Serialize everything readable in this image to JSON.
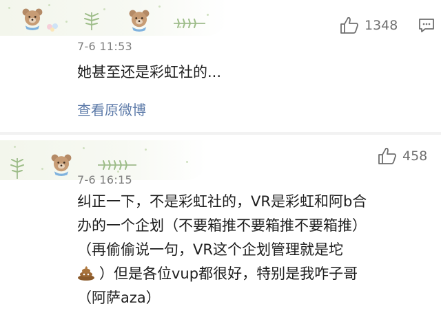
{
  "comments": [
    {
      "timestamp": "7-6 11:53",
      "likes": "1348",
      "text": "她甚至还是彩虹社的...",
      "view_original": "查看原微博"
    },
    {
      "timestamp": "7-6 16:15",
      "likes": "458",
      "lines": [
        "纠正一下，不是彩虹社的，VR是彩虹和阿b合",
        "办的一个企划（不要箱推不要箱推不要箱推）",
        "（再偷偷说一句，VR这个企划管理就是坨",
        "）但是各位vup都很好，特别是我咋子哥",
        "（阿萨aza）"
      ]
    }
  ],
  "icons": {
    "like": "thumbs-up-icon",
    "reply": "comment-icon",
    "poop": "poop-emoji-icon",
    "bear": "bear-avatar-icon"
  },
  "colors": {
    "link": "#5b79a8",
    "timestamp": "#7d7d7d",
    "separator": "#f2f2f2"
  }
}
